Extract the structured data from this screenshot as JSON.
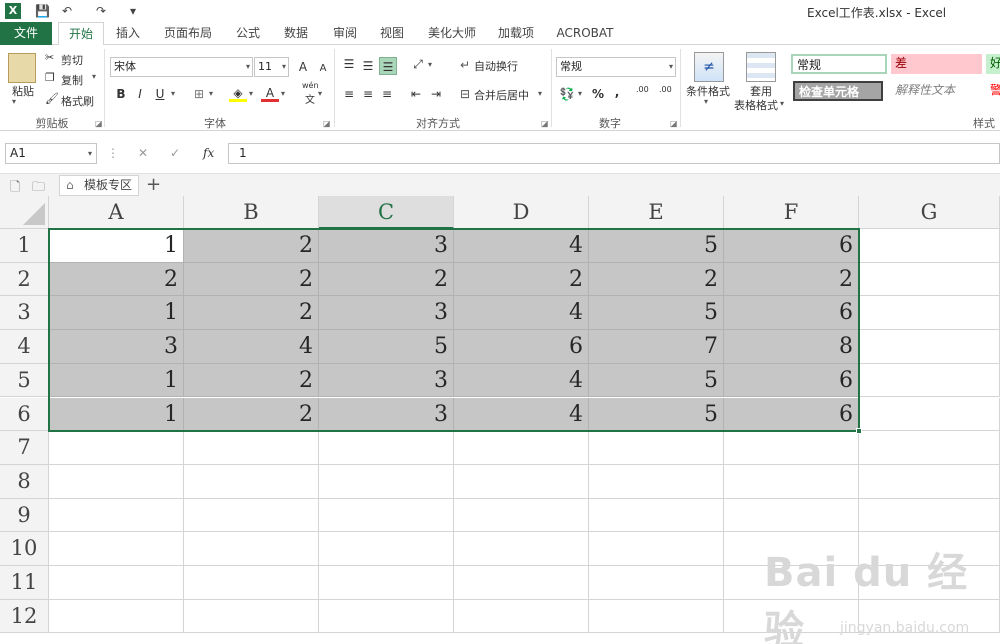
{
  "window": {
    "title": "Excel工作表.xlsx - Excel",
    "app_badge": "X"
  },
  "quick_access": {
    "save": "💾",
    "undo": "↶",
    "redo": "↷",
    "more": "▾"
  },
  "tabs": [
    "文件",
    "开始",
    "插入",
    "页面布局",
    "公式",
    "数据",
    "审阅",
    "视图",
    "美化大师",
    "加载项",
    "ACROBAT"
  ],
  "active_tab": "开始",
  "ribbon": {
    "clipboard": {
      "paste": "粘贴",
      "cut": "剪切",
      "copy": "复制",
      "format_painter": "格式刷",
      "label": "剪贴板"
    },
    "font": {
      "name": "宋体",
      "size": "11",
      "bold": "B",
      "italic": "I",
      "underline": "U",
      "grow": "A",
      "shrink": "A",
      "wen": "wén",
      "wen_char": "文",
      "label": "字体"
    },
    "alignment": {
      "wrap": "自动换行",
      "merge": "合并后居中",
      "label": "对齐方式"
    },
    "number": {
      "format": "常规",
      "percent": "%",
      "comma": ",",
      "inc": ".00",
      "dec": ".00",
      "label": "数字"
    },
    "styles": {
      "conditional": "条件格式",
      "table_format_1": "套用",
      "table_format_2": "表格格式",
      "normal": "常规",
      "bad": "差",
      "good": "好",
      "check": "检查单元格",
      "explain": "解释性文本",
      "warn": "警",
      "label": "样式"
    }
  },
  "formula_bar": {
    "name_box": "A1",
    "cancel": "✕",
    "enter": "✓",
    "fx": "fx",
    "value": "1"
  },
  "sheet_strip": {
    "tab_label": "模板专区",
    "add": "+"
  },
  "columns": [
    "A",
    "B",
    "C",
    "D",
    "E",
    "F",
    "G"
  ],
  "rows": [
    "1",
    "2",
    "3",
    "4",
    "5",
    "6",
    "7",
    "8",
    "9",
    "10",
    "11",
    "12"
  ],
  "cells": [
    [
      "1",
      "2",
      "3",
      "4",
      "5",
      "6"
    ],
    [
      "2",
      "2",
      "2",
      "2",
      "2",
      "2"
    ],
    [
      "1",
      "2",
      "3",
      "4",
      "5",
      "6"
    ],
    [
      "3",
      "4",
      "5",
      "6",
      "7",
      "8"
    ],
    [
      "1",
      "2",
      "3",
      "4",
      "5",
      "6"
    ],
    [
      "1",
      "2",
      "3",
      "4",
      "5",
      "6"
    ]
  ],
  "watermark": {
    "brand": "Bai du 经验",
    "url": "jingyan.baidu.com"
  }
}
